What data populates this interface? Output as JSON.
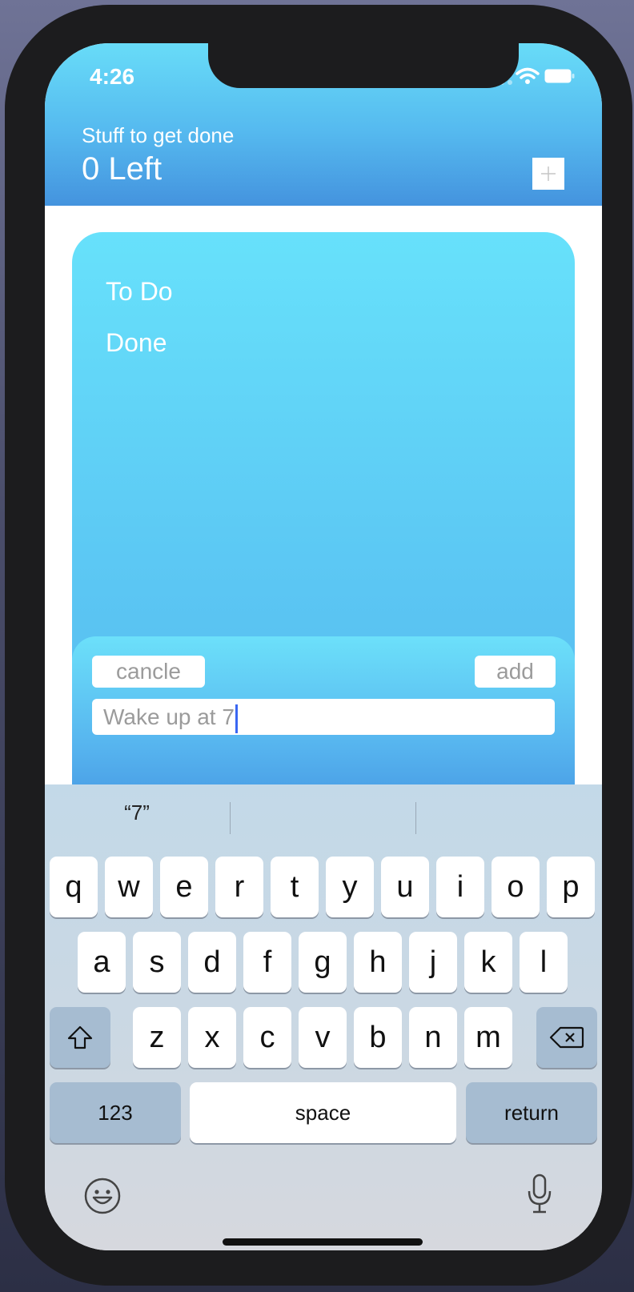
{
  "status_bar": {
    "time": "4:26"
  },
  "header": {
    "subtitle": "Stuff to get done",
    "count_label": "0 Left",
    "add_icon": "plus-icon"
  },
  "tabs": [
    {
      "label": "To Do"
    },
    {
      "label": "Done"
    }
  ],
  "add_panel": {
    "cancel_label": "cancle",
    "add_label": "add",
    "input_value": "Wake up at 7"
  },
  "keyboard": {
    "suggestions": [
      "“7”",
      "",
      ""
    ],
    "rows": [
      [
        "q",
        "w",
        "e",
        "r",
        "t",
        "y",
        "u",
        "i",
        "o",
        "p"
      ],
      [
        "a",
        "s",
        "d",
        "f",
        "g",
        "h",
        "j",
        "k",
        "l"
      ],
      [
        "z",
        "x",
        "c",
        "v",
        "b",
        "n",
        "m"
      ]
    ],
    "numbers_label": "123",
    "space_label": "space",
    "return_label": "return",
    "icons": [
      "shift-icon",
      "delete-icon",
      "emoji-icon",
      "microphone-icon"
    ]
  },
  "colors": {
    "header_top": "#68dcf8",
    "header_bottom": "#4493de",
    "card_top": "#67e1fb",
    "caret": "#3a67f2"
  }
}
